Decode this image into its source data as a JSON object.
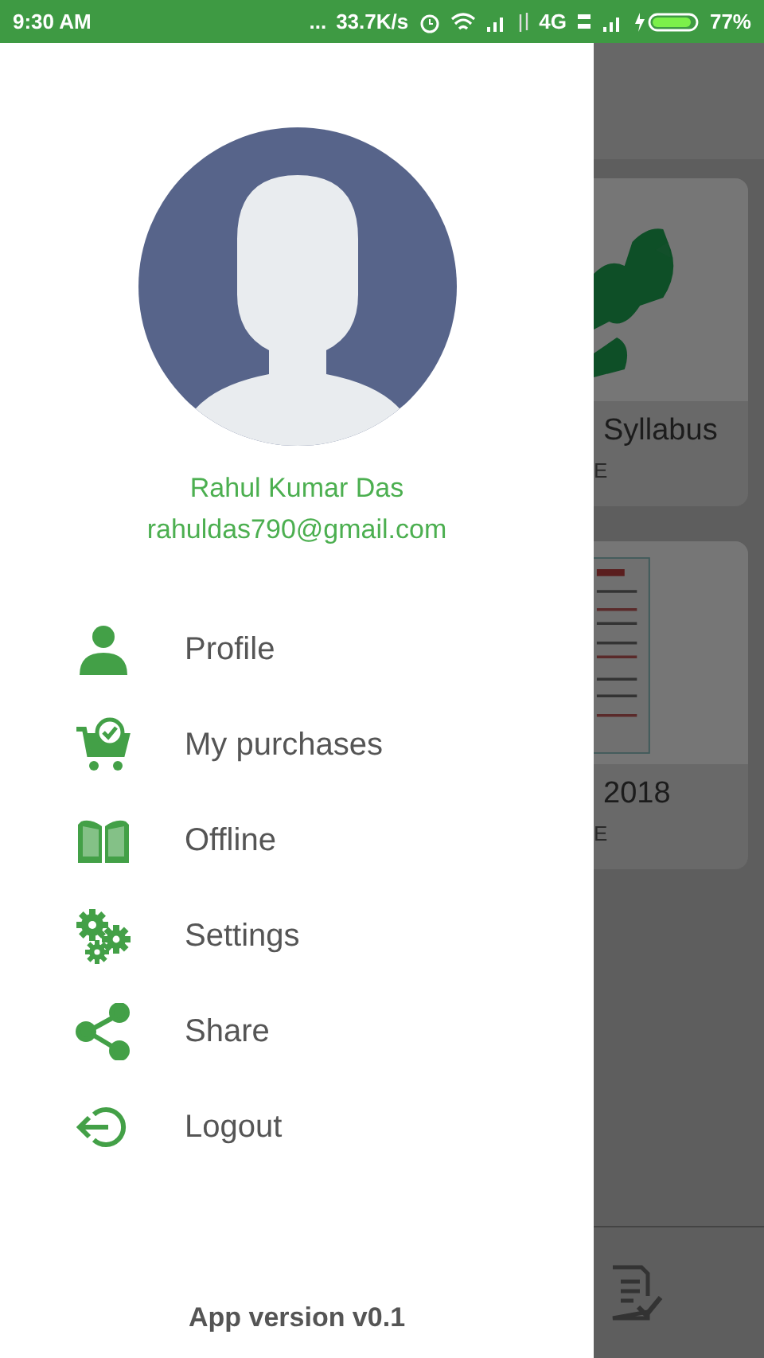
{
  "status_bar": {
    "time": "9:30 AM",
    "dots": "...",
    "speed": "33.7K/s",
    "network": "4G",
    "battery": "77%"
  },
  "background": {
    "cards": [
      {
        "kind": "map",
        "title": "Syllabus",
        "subtitle": "E"
      },
      {
        "kind": "document",
        "title": "2018",
        "subtitle": "E"
      }
    ]
  },
  "drawer": {
    "user_name": "Rahul Kumar Das",
    "email": "rahuldas790@gmail.com",
    "items": [
      {
        "kind": "person",
        "label": "Profile"
      },
      {
        "kind": "cart",
        "label": "My purchases"
      },
      {
        "kind": "book",
        "label": "Offline"
      },
      {
        "kind": "gears",
        "label": "Settings"
      },
      {
        "kind": "share",
        "label": "Share"
      },
      {
        "kind": "logout",
        "label": "Logout"
      }
    ],
    "footer": "App version v0.1"
  }
}
